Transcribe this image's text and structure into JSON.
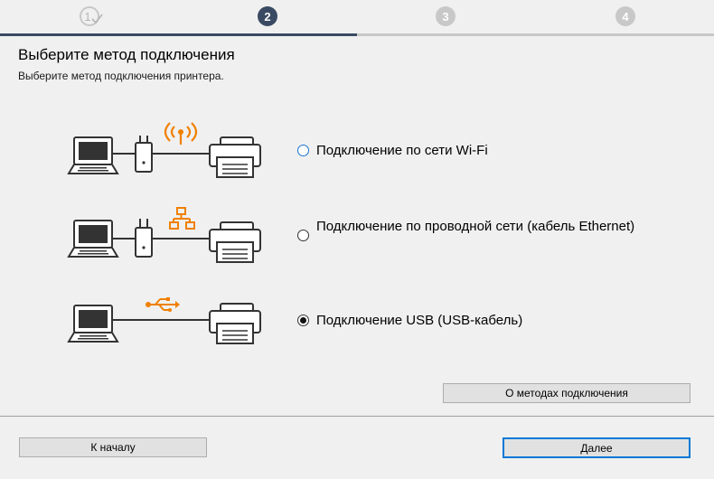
{
  "steps": [
    {
      "label": "1",
      "state": "done"
    },
    {
      "label": "2",
      "state": "current"
    },
    {
      "label": "3",
      "state": "pending"
    },
    {
      "label": "4",
      "state": "pending"
    }
  ],
  "header": {
    "title": "Выберите метод подключения",
    "subtitle": "Выберите метод подключения принтера."
  },
  "options": [
    {
      "label": "Подключение по сети Wi-Fi",
      "selected": false,
      "icon": "wifi-icon"
    },
    {
      "label": "Подключение по проводной сети (кабель Ethernet)",
      "selected": false,
      "icon": "network-icon"
    },
    {
      "label": "Подключение USB (USB-кабель)",
      "selected": true,
      "icon": "usb-icon"
    }
  ],
  "buttons": {
    "about": "О методах подключения",
    "back": "К началу",
    "next": "Далее"
  },
  "colors": {
    "accent": "#f08000",
    "step_active": "#3a4a63",
    "focus": "#0078d7"
  }
}
